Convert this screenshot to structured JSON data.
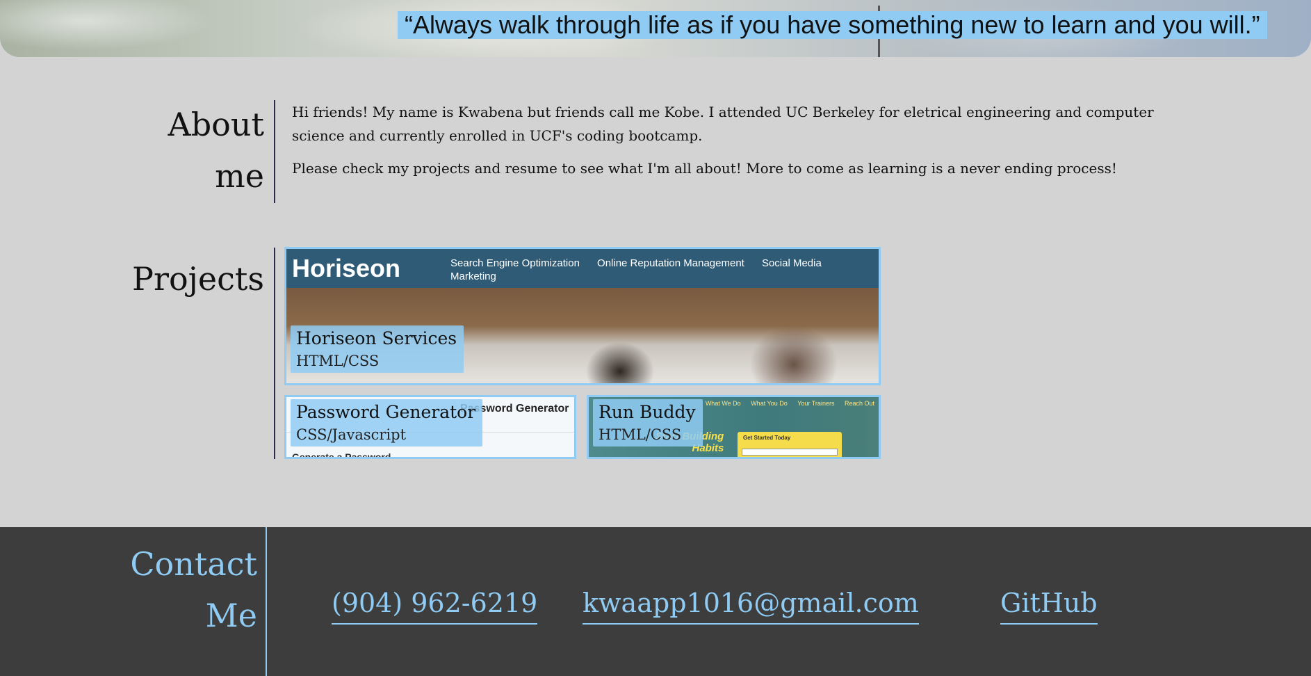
{
  "hero": {
    "quote": "“Always walk through life as if you have something new to learn and you will.”"
  },
  "about": {
    "heading_line1": "About",
    "heading_line2": "me",
    "paragraph1": "Hi friends! My name is Kwabena but friends call me Kobe. I attended UC Berkeley for eletrical engineering and computer science and currently enrolled in UCF's coding bootcamp.",
    "paragraph2": "Please check my projects and resume to see what I'm all about! More to come as learning is a never ending process!"
  },
  "projects": {
    "heading": "Projects",
    "items": [
      {
        "title": "Horiseon Services",
        "tech": "HTML/CSS",
        "preview": {
          "logo": "Horiseon",
          "nav": [
            "Search Engine Optimization",
            "Online Reputation Management",
            "Social Media Marketing"
          ]
        }
      },
      {
        "title": "Password Generator",
        "tech": "CSS/Javascript",
        "preview": {
          "header": "Password Generator",
          "subheader": "Generate a Password"
        }
      },
      {
        "title": "Run Buddy",
        "tech": "HTML/CSS",
        "preview": {
          "nav": [
            "What We Do",
            "What You Do",
            "Your Trainers",
            "Reach Out"
          ],
          "tagline_line1": "Start Building",
          "tagline_line2": "Habits",
          "box_title": "Get Started Today"
        }
      }
    ]
  },
  "contact": {
    "heading_line1": "Contact",
    "heading_line2": "Me",
    "phone": "(904) 962-6219",
    "email": "kwaapp1016@gmail.com",
    "github": "GitHub"
  },
  "colors": {
    "accent": "#8fcbf3",
    "background": "#d3d3d3",
    "footer": "#3d3d3d"
  }
}
